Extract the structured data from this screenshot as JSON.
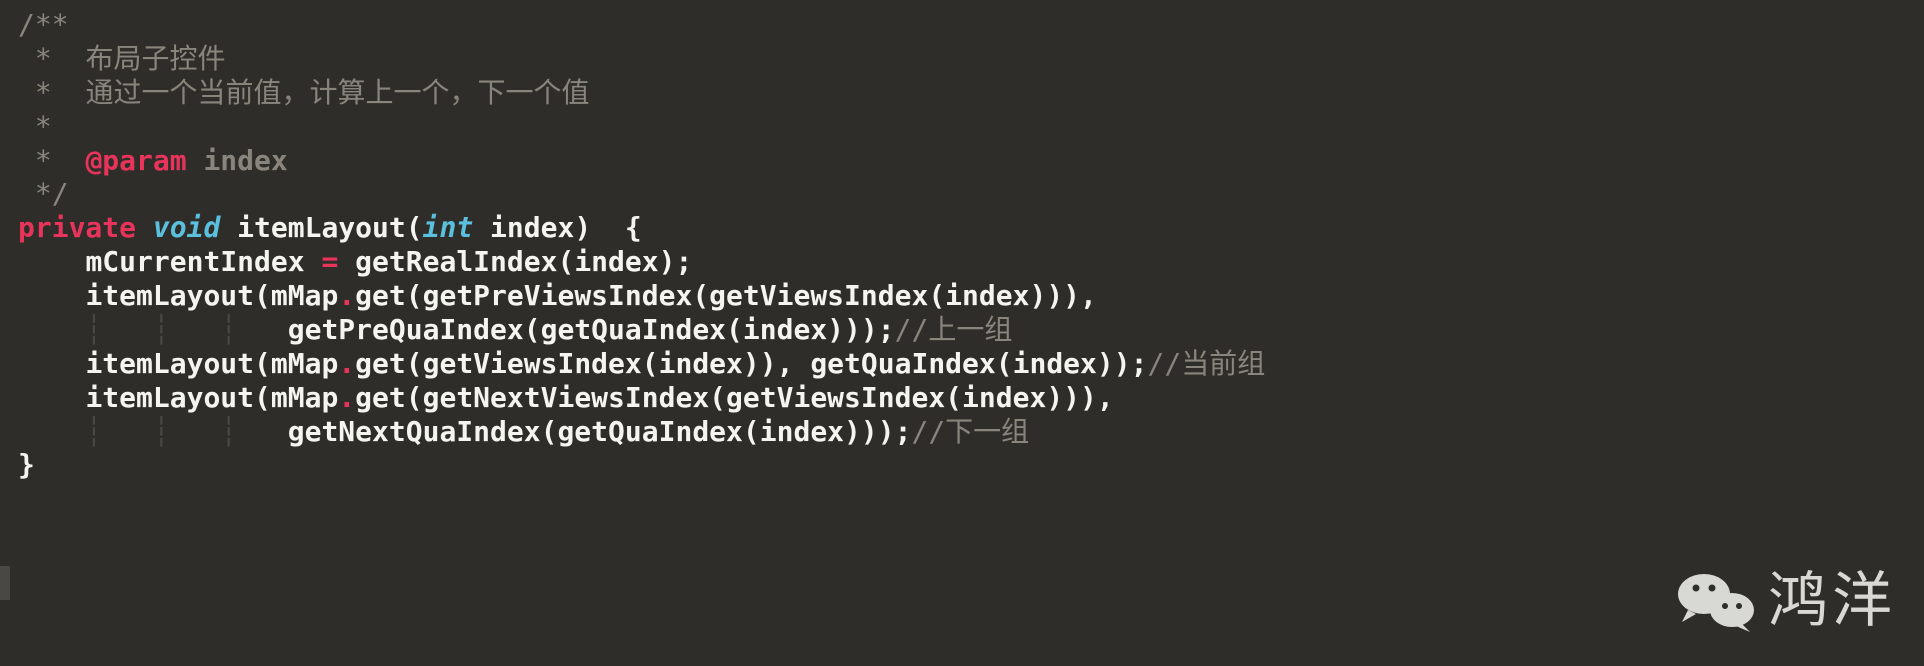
{
  "code": {
    "l1": "/**",
    "l2_prefix": " *  ",
    "l2_text": "布局子控件",
    "l3_prefix": " *  ",
    "l3_text": "通过一个当前值，计算上一个，下一个值",
    "l4": " *",
    "l5_prefix": " *  ",
    "l5_tag": "@param",
    "l5_param": " index",
    "l6": " */",
    "l7_kw1": "private",
    "l7_sp1": " ",
    "l7_kw2": "void",
    "l7_sp2": " ",
    "l7_method": "itemLayout(",
    "l7_kw3": "int",
    "l7_rest": " index)  {",
    "l8_indent": "    ",
    "l8_text": "mCurrentIndex ",
    "l8_op": "=",
    "l8_rest": " getRealIndex(index);",
    "l9_indent": "    ",
    "l9_a": "itemLayout(mMap",
    "l9_dot": ".",
    "l9_b": "get(getPreViewsIndex(getViewsIndex(index))),",
    "l10_indent": "    ",
    "l10_guides": "┆   ┆   ┆   ",
    "l10_text": "getPreQuaIndex(getQuaIndex(index)));",
    "l10_comment": "//上一组",
    "l11_indent": "    ",
    "l11_a": "itemLayout(mMap",
    "l11_dot": ".",
    "l11_b": "get(getViewsIndex(index)), getQuaIndex(index));",
    "l11_comment": "//当前组",
    "l12_indent": "    ",
    "l12_a": "itemLayout(mMap",
    "l12_dot": ".",
    "l12_b": "get(getNextViewsIndex(getViewsIndex(index))),",
    "l13_indent": "    ",
    "l13_guides": "┆   ┆   ┆   ",
    "l13_text": "getNextQuaIndex(getQuaIndex(index)));",
    "l13_comment": "//下一组",
    "l14": "}"
  },
  "watermark": {
    "text": "鸿洋"
  }
}
